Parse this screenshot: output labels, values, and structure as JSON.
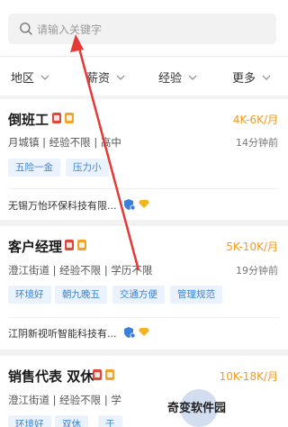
{
  "search": {
    "placeholder": "请输入关键字"
  },
  "filters": [
    {
      "label": "地区"
    },
    {
      "label": "薪资"
    },
    {
      "label": "经验"
    },
    {
      "label": "更多"
    }
  ],
  "jobs": [
    {
      "title": "倒班工",
      "salary": "4K-6K/月",
      "meta": "月城镇 | 经验不限 | 高中",
      "time": "14分钟前",
      "tags": [
        "五险一金",
        "压力小"
      ],
      "company": "无锡万怡环保科技有限..."
    },
    {
      "title": "客户经理",
      "salary": "5K-10K/月",
      "meta": "澄江街道 | 经验不限 | 学历不限",
      "time": "19分钟前",
      "tags": [
        "环境好",
        "朝九晚五",
        "交通方便",
        "管理规范"
      ],
      "company": "江阴新视听智能科技有..."
    },
    {
      "title": "销售代表 双休",
      "salary": "10K-18K/月",
      "meta": "澄江街道 | 经验不限 | 学",
      "tags": [
        "环境好",
        "双休",
        "于"
      ]
    }
  ],
  "watermark": {
    "text": "奇变软件园"
  },
  "colors": {
    "salary": "#f39a1d",
    "tag_text": "#3c82d6",
    "tag_bg": "#eaf3fd",
    "arrow": "#e53935",
    "badge_red": "#e2453a",
    "badge_gold": "#f1a428"
  }
}
